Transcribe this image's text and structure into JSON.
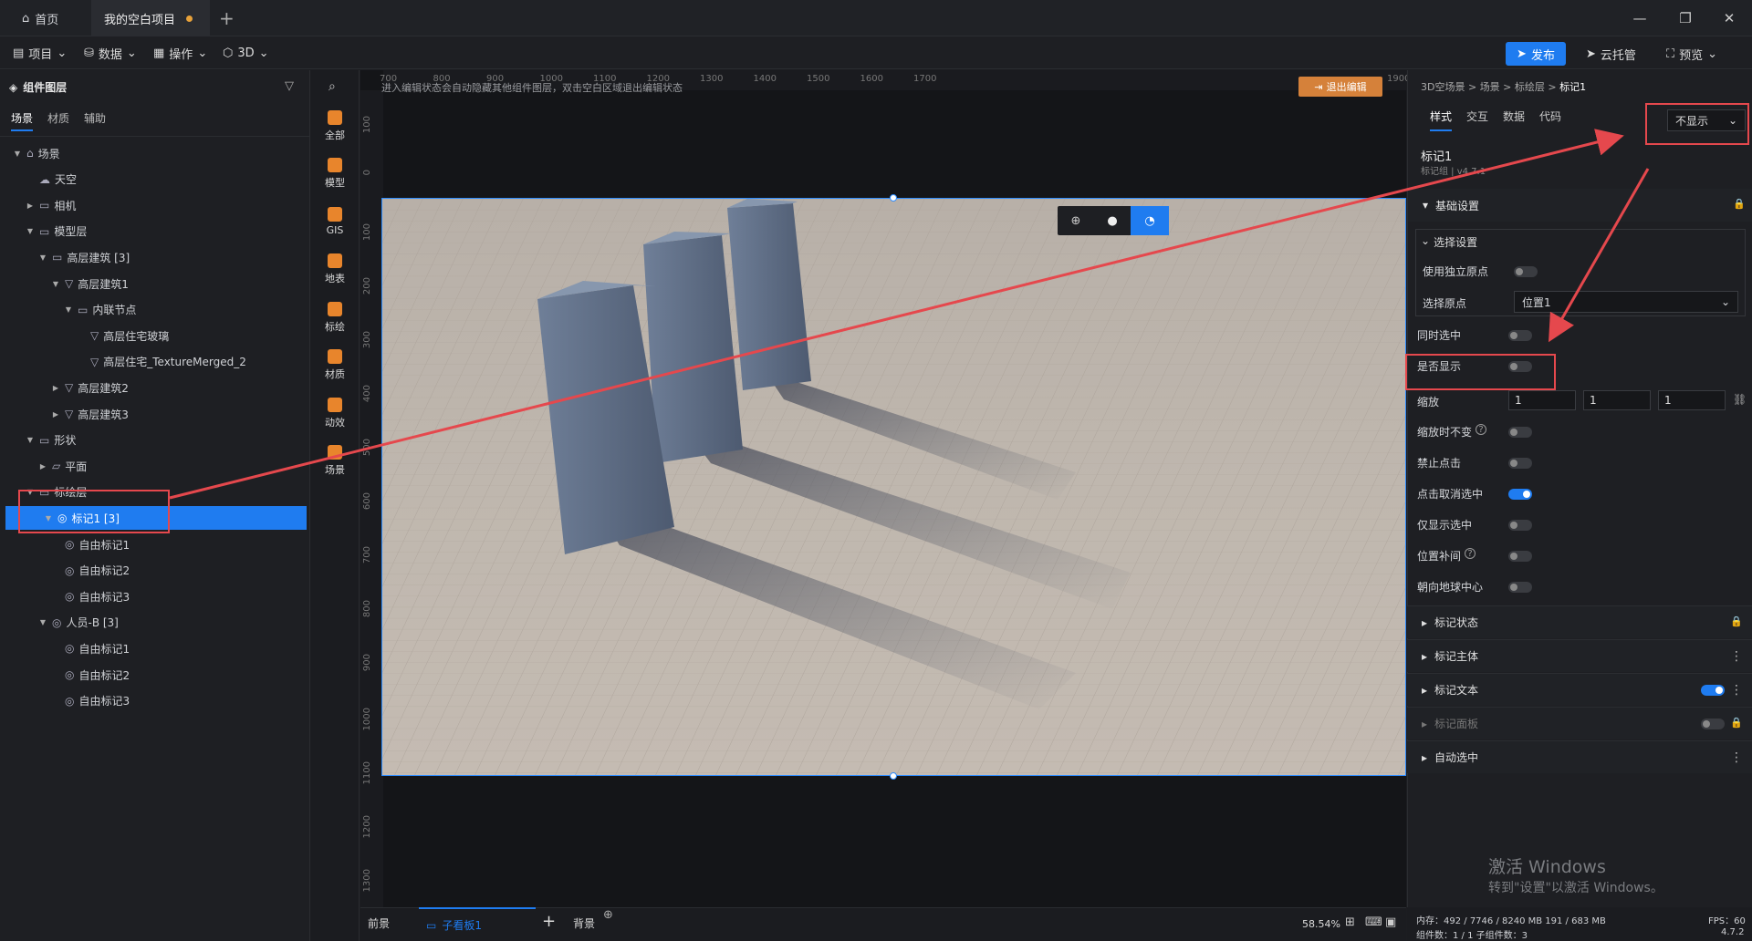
{
  "tabs": {
    "home": "首页",
    "project": "我的空白项目"
  },
  "menu": {
    "project": "项目",
    "data": "数据",
    "operate": "操作",
    "three_d": "3D"
  },
  "actions": {
    "publish": "发布",
    "cloud": "云托管",
    "preview": "预览"
  },
  "left": {
    "title": "组件图层",
    "tabs": [
      "场景",
      "材质",
      "辅助"
    ],
    "tree": [
      {
        "label": "场景",
        "depth": 0,
        "caret": "▼",
        "icon": "scene-icon"
      },
      {
        "label": "天空",
        "depth": 1,
        "caret": "",
        "icon": "sky-icon"
      },
      {
        "label": "相机",
        "depth": 1,
        "caret": "▶",
        "icon": "folder-icon"
      },
      {
        "label": "模型层",
        "depth": 1,
        "caret": "▼",
        "icon": "folder-icon"
      },
      {
        "label": "高层建筑 [3]",
        "depth": 2,
        "caret": "▼",
        "icon": "folder-icon"
      },
      {
        "label": "高层建筑1",
        "depth": 3,
        "caret": "▼",
        "icon": "mesh-icon"
      },
      {
        "label": "内联节点",
        "depth": 4,
        "caret": "▼",
        "icon": "folder-icon"
      },
      {
        "label": "高层住宅玻璃",
        "depth": 5,
        "caret": "",
        "icon": "mesh-icon"
      },
      {
        "label": "高层住宅_TextureMerged_2",
        "depth": 5,
        "caret": "",
        "icon": "mesh-icon"
      },
      {
        "label": "高层建筑2",
        "depth": 3,
        "caret": "▶",
        "icon": "mesh-icon"
      },
      {
        "label": "高层建筑3",
        "depth": 3,
        "caret": "▶",
        "icon": "mesh-icon"
      },
      {
        "label": "形状",
        "depth": 1,
        "caret": "▼",
        "icon": "folder-icon"
      },
      {
        "label": "平面",
        "depth": 2,
        "caret": "▶",
        "icon": "plane-icon"
      },
      {
        "label": "标绘层",
        "depth": 1,
        "caret": "▼",
        "icon": "folder-icon"
      },
      {
        "label": "标记1 [3]",
        "depth": 2,
        "caret": "▼",
        "icon": "marker-icon",
        "selected": true
      },
      {
        "label": "自由标记1",
        "depth": 3,
        "caret": "",
        "icon": "marker-icon"
      },
      {
        "label": "自由标记2",
        "depth": 3,
        "caret": "",
        "icon": "marker-icon"
      },
      {
        "label": "自由标记3",
        "depth": 3,
        "caret": "",
        "icon": "marker-icon"
      },
      {
        "label": "人员-B [3]",
        "depth": 2,
        "caret": "▼",
        "icon": "marker-icon"
      },
      {
        "label": "自由标记1",
        "depth": 3,
        "caret": "",
        "icon": "marker-icon"
      },
      {
        "label": "自由标记2",
        "depth": 3,
        "caret": "",
        "icon": "marker-icon"
      },
      {
        "label": "自由标记3",
        "depth": 3,
        "caret": "",
        "icon": "marker-icon"
      }
    ]
  },
  "tools": [
    {
      "label": "全部",
      "color": "#e8852c"
    },
    {
      "label": "模型",
      "color": "#e8852c"
    },
    {
      "label": "GIS",
      "color": "#e8852c"
    },
    {
      "label": "地表",
      "color": "#e8852c"
    },
    {
      "label": "标绘",
      "color": "#e8852c"
    },
    {
      "label": "材质",
      "color": "#e8852c"
    },
    {
      "label": "动效",
      "color": "#e8852c"
    },
    {
      "label": "场景",
      "color": "#e8852c"
    }
  ],
  "canvas": {
    "hint": "进入编辑状态会自动隐藏其他组件图层，双击空白区域退出编辑状态",
    "exit_edit": "退出编辑",
    "ruler_top": [
      "700",
      "800",
      "900",
      "1000",
      "1100",
      "1200",
      "1300",
      "1400",
      "1500",
      "1600",
      "1700",
      "1900"
    ],
    "ruler_left": [
      "100",
      "0",
      "100",
      "200",
      "300",
      "400",
      "500",
      "600",
      "700",
      "800",
      "900",
      "1000",
      "1100",
      "1200",
      "1300"
    ]
  },
  "bottom": {
    "front": "前景",
    "board": "子看板1",
    "background": "背景",
    "zoom": "58.54%"
  },
  "right": {
    "breadcrumb": [
      "3D空场景",
      "场景",
      "标绘层",
      "标记1"
    ],
    "tabs": [
      "样式",
      "交互",
      "数据",
      "代码"
    ],
    "visibility_select": "不显示",
    "component_name": "标记1",
    "component_sub": "标记组 | v4.7.1",
    "basic_settings": "基础设置",
    "select_settings": "选择设置",
    "use_own_origin": "使用独立原点",
    "select_origin_label": "选择原点",
    "select_origin_value": "位置1",
    "props": [
      {
        "label": "同时选中",
        "on": false
      },
      {
        "label": "是否显示",
        "on": false
      }
    ],
    "scale_label": "缩放",
    "scale": [
      "1",
      "1",
      "1"
    ],
    "props2": [
      {
        "label": "缩放时不变",
        "on": false,
        "help": true
      },
      {
        "label": "禁止点击",
        "on": false,
        "help": false
      },
      {
        "label": "点击取消选中",
        "on": true,
        "help": false
      },
      {
        "label": "仅显示选中",
        "on": false,
        "help": false
      },
      {
        "label": "位置补间",
        "on": false,
        "help": true
      },
      {
        "label": "朝向地球中心",
        "on": false,
        "help": false
      }
    ],
    "sections": [
      {
        "label": "标记状态",
        "trail": "lock",
        "toggle": null
      },
      {
        "label": "标记主体",
        "trail": "more",
        "toggle": null
      },
      {
        "label": "标记文本",
        "trail": "more",
        "toggle": true
      },
      {
        "label": "标记面板",
        "trail": "lock",
        "toggle": false
      },
      {
        "label": "自动选中",
        "trail": "more",
        "toggle": null
      }
    ]
  },
  "watermark": {
    "line1": "激活 Windows",
    "line2": "转到\"设置\"以激活 Windows。"
  },
  "status": {
    "memory": "内存：492 / 7746 / 8240 MB  191 / 683 MB",
    "fps": "FPS：60",
    "count": "组件数：1 / 1   子组件数：3",
    "version": "4.7.2"
  },
  "colors": {
    "accent": "#1f7cf0",
    "highlight": "#e5484d",
    "warning_btn": "#d5813a"
  }
}
